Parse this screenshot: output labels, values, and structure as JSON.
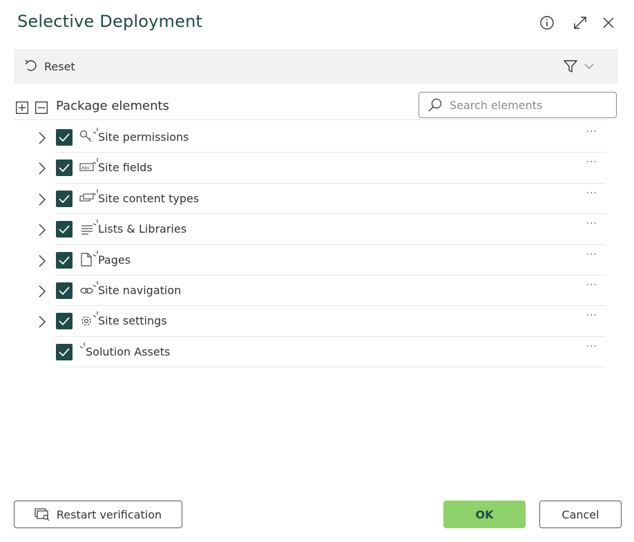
{
  "dialog": {
    "title": "Selective Deployment"
  },
  "toolbar": {
    "reset_label": "Reset"
  },
  "tree": {
    "header_label": "Package elements",
    "search_placeholder": "Search elements",
    "items": [
      {
        "label": "Site permissions",
        "icon": "key-icon",
        "checked": true,
        "expandable": true
      },
      {
        "label": "Site fields",
        "icon": "abc-field-icon",
        "checked": true,
        "expandable": true
      },
      {
        "label": "Site content types",
        "icon": "content-type-icon",
        "checked": true,
        "expandable": true
      },
      {
        "label": "Lists & Libraries",
        "icon": "list-icon",
        "checked": true,
        "expandable": true
      },
      {
        "label": "Pages",
        "icon": "page-icon",
        "checked": true,
        "expandable": true
      },
      {
        "label": "Site navigation",
        "icon": "link-icon",
        "checked": true,
        "expandable": true
      },
      {
        "label": "Site settings",
        "icon": "gear-icon",
        "checked": true,
        "expandable": true
      },
      {
        "label": "Solution Assets",
        "icon": "",
        "checked": true,
        "expandable": false
      }
    ],
    "more_label": "···"
  },
  "footer": {
    "restart_label": "Restart verification",
    "ok_label": "OK",
    "cancel_label": "Cancel"
  },
  "colors": {
    "accent": "#1f4a47",
    "ok": "#8fd16b",
    "toolbar_bg": "#f3f2f1"
  }
}
